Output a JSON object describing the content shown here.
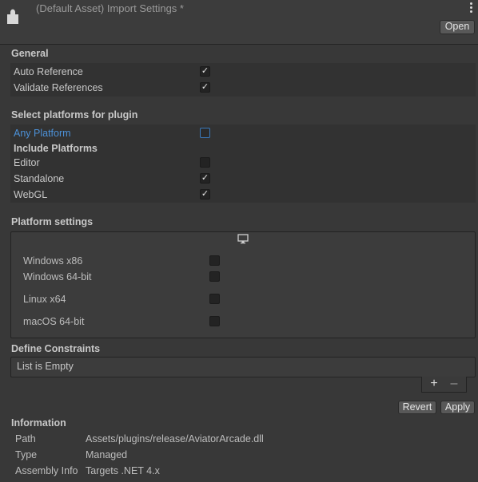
{
  "header": {
    "title": "(Default Asset) Import Settings *",
    "open_label": "Open",
    "icon": "plugin-puzzle-icon",
    "menu_icon": "kebab-menu-icon"
  },
  "general": {
    "title": "General",
    "items": [
      {
        "label": "Auto Reference",
        "checked": true
      },
      {
        "label": "Validate References",
        "checked": true
      }
    ]
  },
  "platforms": {
    "title": "Select platforms for plugin",
    "any_platform_label": "Any Platform",
    "any_platform_checked": false,
    "include_title": "Include Platforms",
    "items": [
      {
        "label": "Editor",
        "checked": false
      },
      {
        "label": "Standalone",
        "checked": true
      },
      {
        "label": "WebGL",
        "checked": true
      }
    ]
  },
  "platform_settings": {
    "title": "Platform settings",
    "tab_icon": "monitor-icon",
    "items": [
      {
        "label": "Windows x86",
        "checked": false
      },
      {
        "label": "Windows 64-bit",
        "checked": false
      },
      {
        "label": "Linux x64",
        "checked": false
      },
      {
        "label": "macOS 64-bit",
        "checked": false
      }
    ]
  },
  "define_constraints": {
    "title": "Define Constraints",
    "empty_text": "List is Empty",
    "add_label": "+",
    "remove_label": "–"
  },
  "actions": {
    "revert_label": "Revert",
    "apply_label": "Apply"
  },
  "information": {
    "title": "Information",
    "rows": [
      {
        "key": "Path",
        "value": "Assets/plugins/release/AviatorArcade.dll"
      },
      {
        "key": "Type",
        "value": "Managed"
      },
      {
        "key": "Assembly Info",
        "value": "Targets .NET 4.x"
      }
    ]
  },
  "colors": {
    "background": "#383838",
    "accent_blue": "#4c91d8"
  }
}
